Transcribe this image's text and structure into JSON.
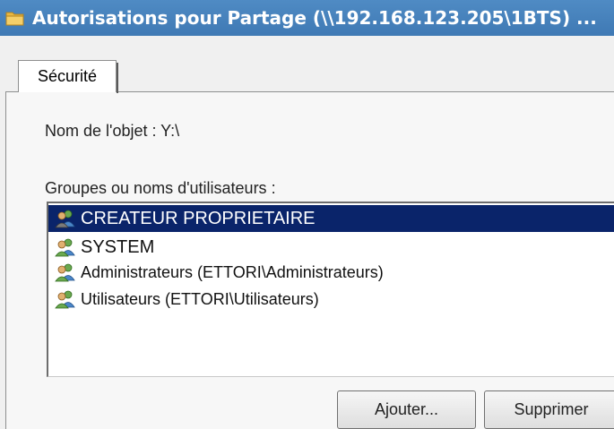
{
  "window": {
    "title": "Autorisations pour Partage (\\\\192.168.123.205\\1BTS) ..."
  },
  "tabs": [
    {
      "label": "Sécurité",
      "active": true
    }
  ],
  "object": {
    "label": "Nom de l'objet :  Y:\\"
  },
  "groups": {
    "label": "Groupes ou noms d'utilisateurs :",
    "items": [
      {
        "label": "CREATEUR PROPRIETAIRE",
        "icon": "users-icon",
        "selected": true
      },
      {
        "label": "SYSTEM",
        "icon": "users-icon",
        "selected": false
      },
      {
        "label": "Administrateurs (ETTORI\\Administrateurs)",
        "icon": "users-icon",
        "selected": false
      },
      {
        "label": "Utilisateurs (ETTORI\\Utilisateurs)",
        "icon": "users-icon",
        "selected": false
      }
    ]
  },
  "buttons": {
    "add_label": "Ajouter...",
    "remove_label": "Supprimer"
  },
  "colors": {
    "titlebar": "#3f79b4",
    "selection": "#0a246a"
  }
}
